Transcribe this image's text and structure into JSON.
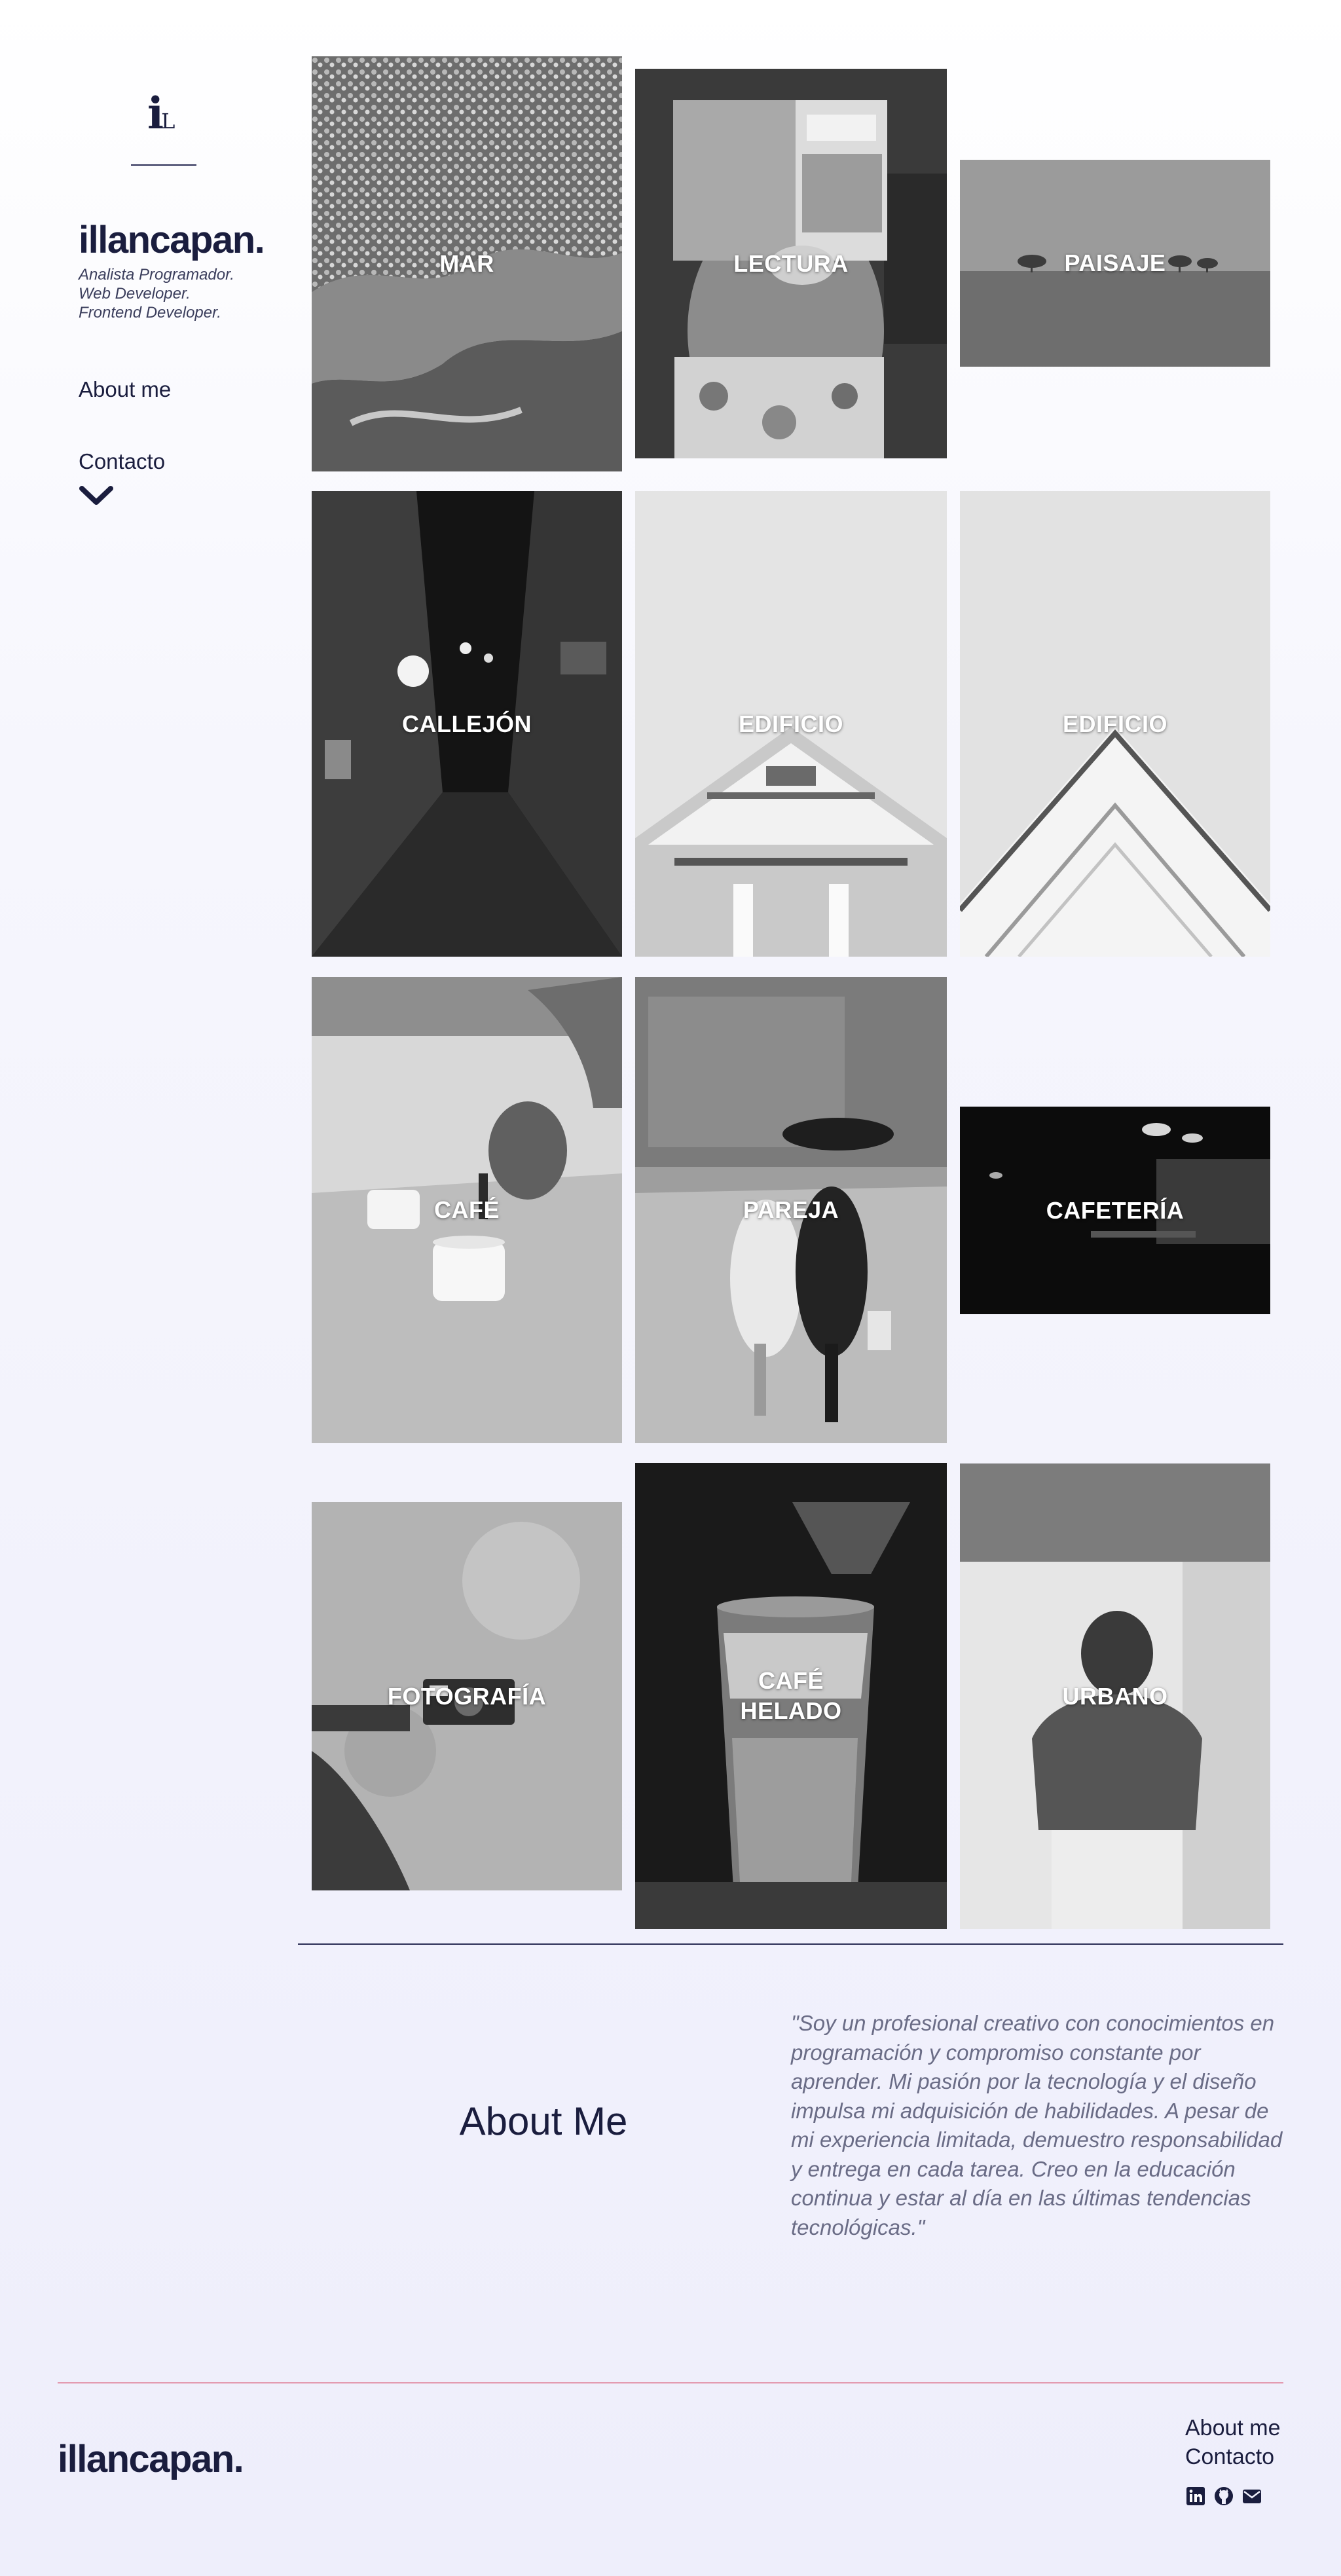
{
  "sidebar": {
    "logo_letter": "i",
    "logo_small": "L",
    "brand": "illancapan.",
    "taglines": [
      "Analista Programador.",
      "Web Developer.",
      "Frontend Developer."
    ],
    "nav": {
      "about": "About me",
      "contact": "Contacto"
    },
    "chevron_icon": "chevron-down-icon"
  },
  "gallery": {
    "tiles": [
      {
        "label": "MAR"
      },
      {
        "label": "LECTURA"
      },
      {
        "label": "PAISAJE"
      },
      {
        "label": "CALLEJÓN"
      },
      {
        "label": "EDIFICIO"
      },
      {
        "label": "EDIFICIO"
      },
      {
        "label": "CAFÉ"
      },
      {
        "label": "PAREJA"
      },
      {
        "label": "CAFETERÍA"
      },
      {
        "label": "FOTOGRAFÍA"
      },
      {
        "label": "CAFÉ\nHELADO"
      },
      {
        "label": "URBANO"
      }
    ]
  },
  "about": {
    "title": "About Me",
    "quote": "\"Soy un profesional creativo con conocimientos en programación y compromiso constante por aprender. Mi pasión por la tecnología y el diseño impulsa mi adquisición de habilidades. A pesar de mi experiencia limitada, demuestro responsabilidad y entrega en cada tarea. Creo en la educación continua y estar al día en las últimas tendencias tecnológicas.\""
  },
  "footer": {
    "brand": "illancapan.",
    "nav": {
      "about": "About me",
      "contact": "Contacto"
    },
    "social": [
      "linkedin-icon",
      "github-icon",
      "email-icon"
    ]
  },
  "colors": {
    "primary": "#1a1d3e",
    "muted": "#6a6c86",
    "footer_rule": "#e39ab0",
    "background": "#eeeefb"
  }
}
